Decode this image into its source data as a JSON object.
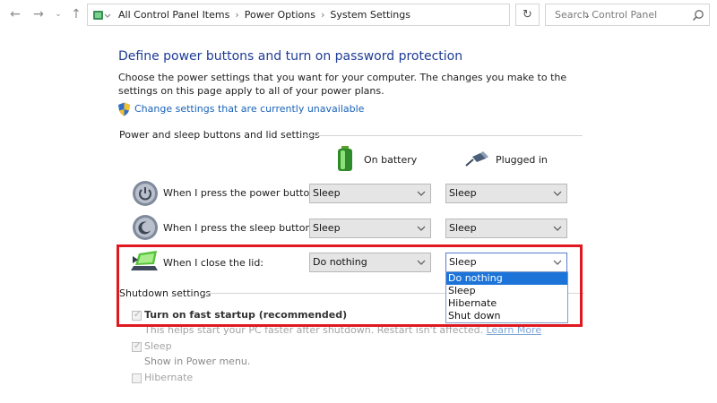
{
  "address_bar": {
    "crumbs": [
      "All Control Panel Items",
      "Power Options",
      "System Settings"
    ],
    "search_placeholder": "Search Control Panel"
  },
  "page": {
    "title": "Define power buttons and turn on password protection",
    "description": "Choose the power settings that you want for your computer. The changes you make to the settings on this page apply to all of your power plans.",
    "change_link": "Change settings that are currently unavailable"
  },
  "power_section": {
    "title": "Power and sleep buttons and lid settings",
    "columns": {
      "battery": "On battery",
      "plugged": "Plugged in"
    },
    "rows": [
      {
        "label": "When I press the power button:",
        "battery": "Sleep",
        "plugged": "Sleep"
      },
      {
        "label": "When I press the sleep button:",
        "battery": "Sleep",
        "plugged": "Sleep"
      },
      {
        "label": "When I close the lid:",
        "battery": "Do nothing",
        "plugged": "Sleep"
      }
    ],
    "open_dropdown": {
      "options": [
        "Do nothing",
        "Sleep",
        "Hibernate",
        "Shut down"
      ],
      "highlighted": "Do nothing"
    }
  },
  "shutdown_section": {
    "title": "Shutdown settings",
    "fast_startup": {
      "label": "Turn on fast startup (recommended)",
      "checked": true,
      "hint": "This helps start your PC faster after shutdown. Restart isn't affected.",
      "learn_more": "Learn More"
    },
    "sleep": {
      "label": "Sleep",
      "checked": false,
      "sub": "Show in Power menu."
    },
    "hibernate": {
      "label": "Hibernate",
      "checked": false
    }
  },
  "colors": {
    "heading": "#1e3c96",
    "link": "#1a63b8",
    "highlight_border": "#e0181f",
    "selection": "#1c74d8"
  }
}
